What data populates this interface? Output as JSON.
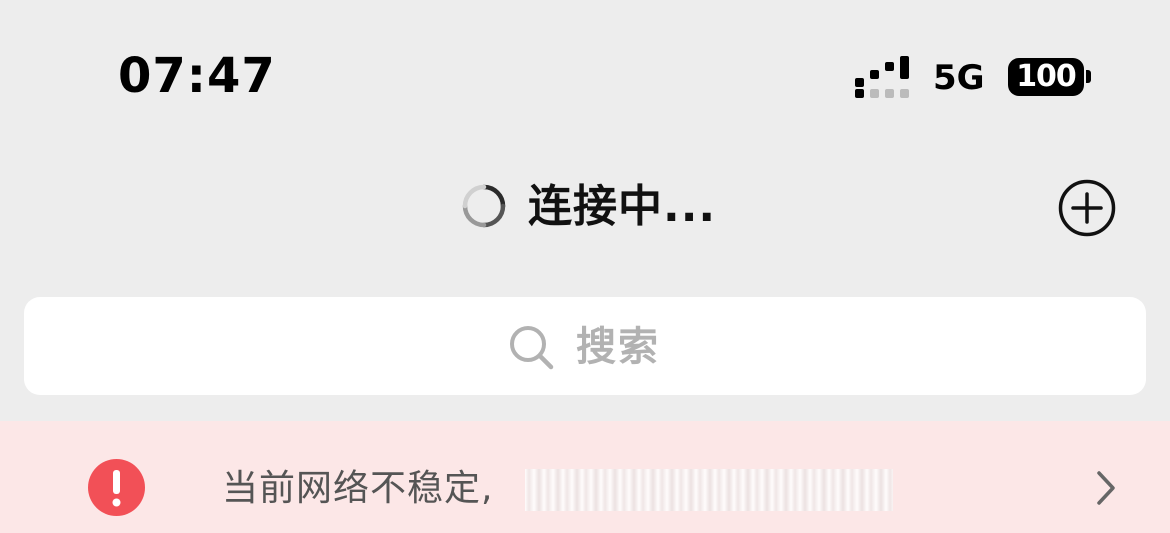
{
  "status_bar": {
    "time": "07:47",
    "network": "5G",
    "battery": "100"
  },
  "nav": {
    "title": "连接中..."
  },
  "search": {
    "placeholder": "搜索"
  },
  "banner": {
    "text": "当前网络不稳定,"
  },
  "colors": {
    "background": "#ededed",
    "banner_bg": "#fce7e7",
    "warning_red": "#f25057",
    "placeholder_gray": "#b2b2b2"
  },
  "icons": {
    "spinner": "loading-spinner-icon",
    "add": "plus-circle-icon",
    "search": "search-icon",
    "warning": "exclamation-circle-icon",
    "chevron": "chevron-right-icon"
  }
}
